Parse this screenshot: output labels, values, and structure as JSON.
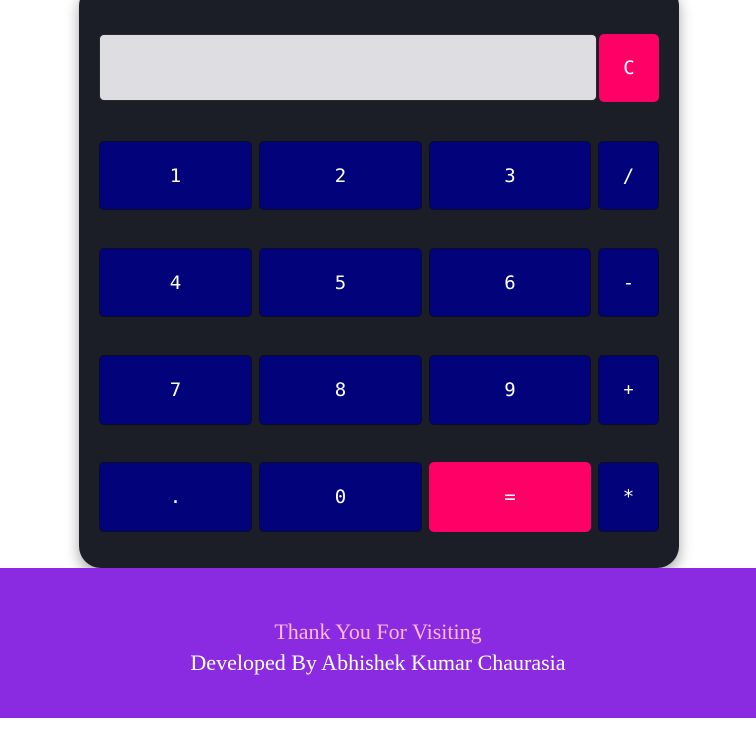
{
  "calculator": {
    "display_value": "",
    "clear_label": "C",
    "keys": {
      "one": "1",
      "two": "2",
      "three": "3",
      "divide": "/",
      "four": "4",
      "five": "5",
      "six": "6",
      "minus": "-",
      "seven": "7",
      "eight": "8",
      "nine": "9",
      "plus": "+",
      "dot": ".",
      "zero": "0",
      "equals": "=",
      "multiply": "*"
    },
    "colors": {
      "body": "#1b1d27",
      "key": "#02027b",
      "accent": "#ff0066",
      "display": "#dedde2"
    }
  },
  "footer": {
    "line1": "Thank You For Visiting",
    "line2": "Developed By Abhishek Kumar Chaurasia",
    "background": "#8a2be2"
  }
}
